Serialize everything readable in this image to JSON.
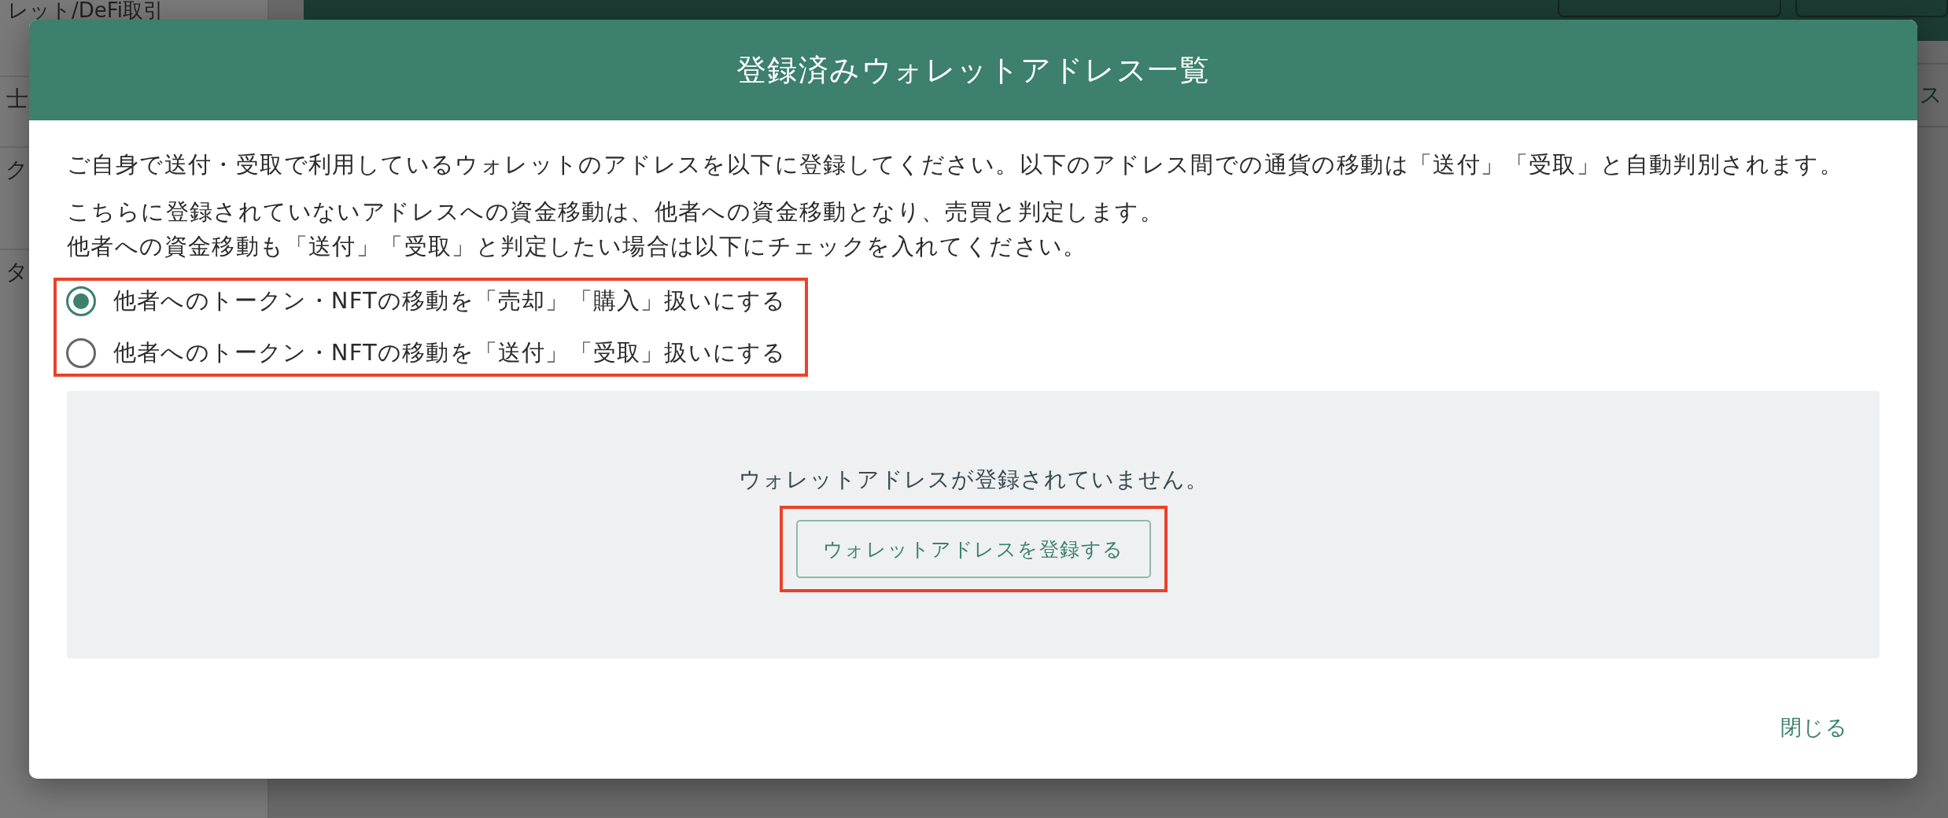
{
  "background": {
    "top_item": "レット/DeFi取引",
    "sidebar_items": [
      "士",
      "ク",
      "タ"
    ],
    "side_label": "ス"
  },
  "dialog": {
    "title": "登録済みウォレットアドレス一覧",
    "intro": "ご自身で送付・受取で利用しているウォレットのアドレスを以下に登録してください。以下のアドレス間での通貨の移動は「送付」「受取」と自動判別されます。",
    "notes": [
      "こちらに登録されていないアドレスへの資金移動は、他者への資金移動となり、売買と判定します。",
      "他者への資金移動も「送付」「受取」と判定したい場合は以下にチェックを入れてください。"
    ],
    "options": [
      {
        "label": "他者へのトークン・NFTの移動を「売却」「購入」扱いにする",
        "selected": true
      },
      {
        "label": "他者へのトークン・NFTの移動を「送付」「受取」扱いにする",
        "selected": false
      }
    ],
    "empty_message": "ウォレットアドレスが登録されていません。",
    "register_button": "ウォレットアドレスを登録する",
    "close_link": "閉じる"
  }
}
